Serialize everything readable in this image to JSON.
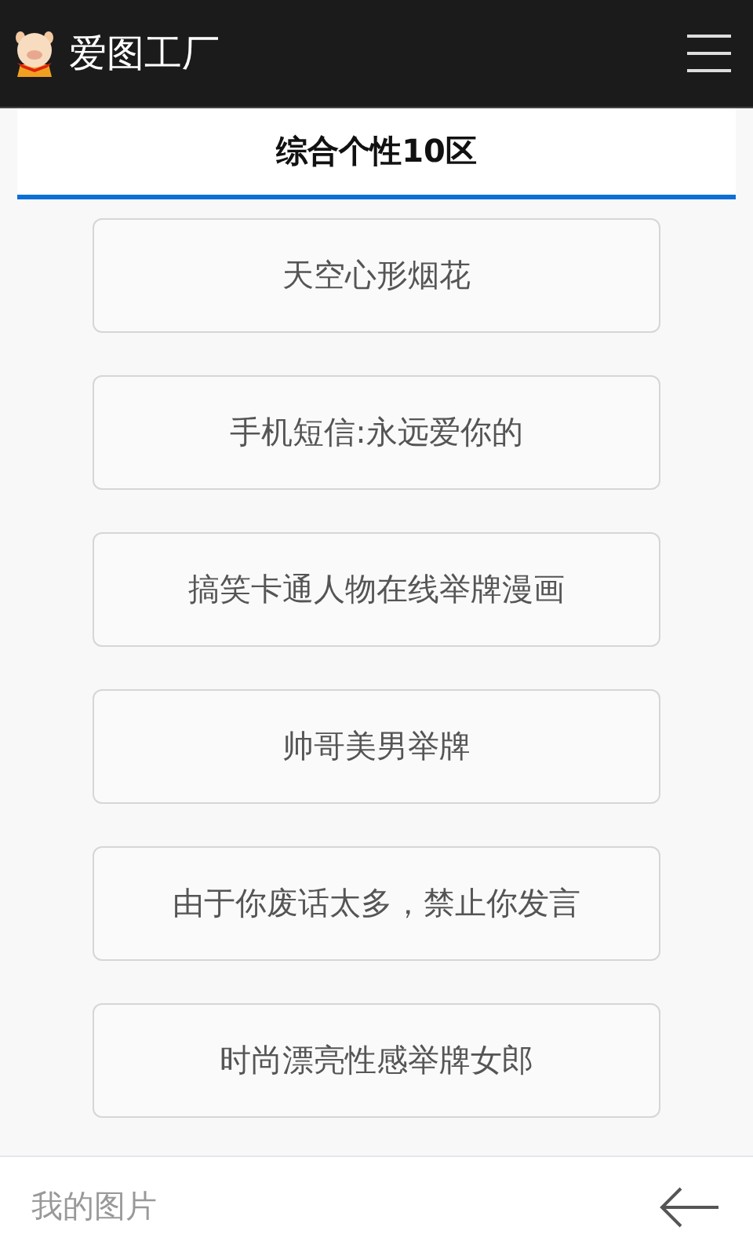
{
  "app_bar": {
    "title": "爱图工厂"
  },
  "section": {
    "title": "综合个性10区"
  },
  "items": [
    "天空心形烟花",
    "手机短信:永远爱你的",
    "搞笑卡通人物在线举牌漫画",
    "帅哥美男举牌",
    "由于你废话太多，禁止你发言",
    "时尚漂亮性感举牌女郎"
  ],
  "bottom_bar": {
    "label": "我的图片"
  }
}
